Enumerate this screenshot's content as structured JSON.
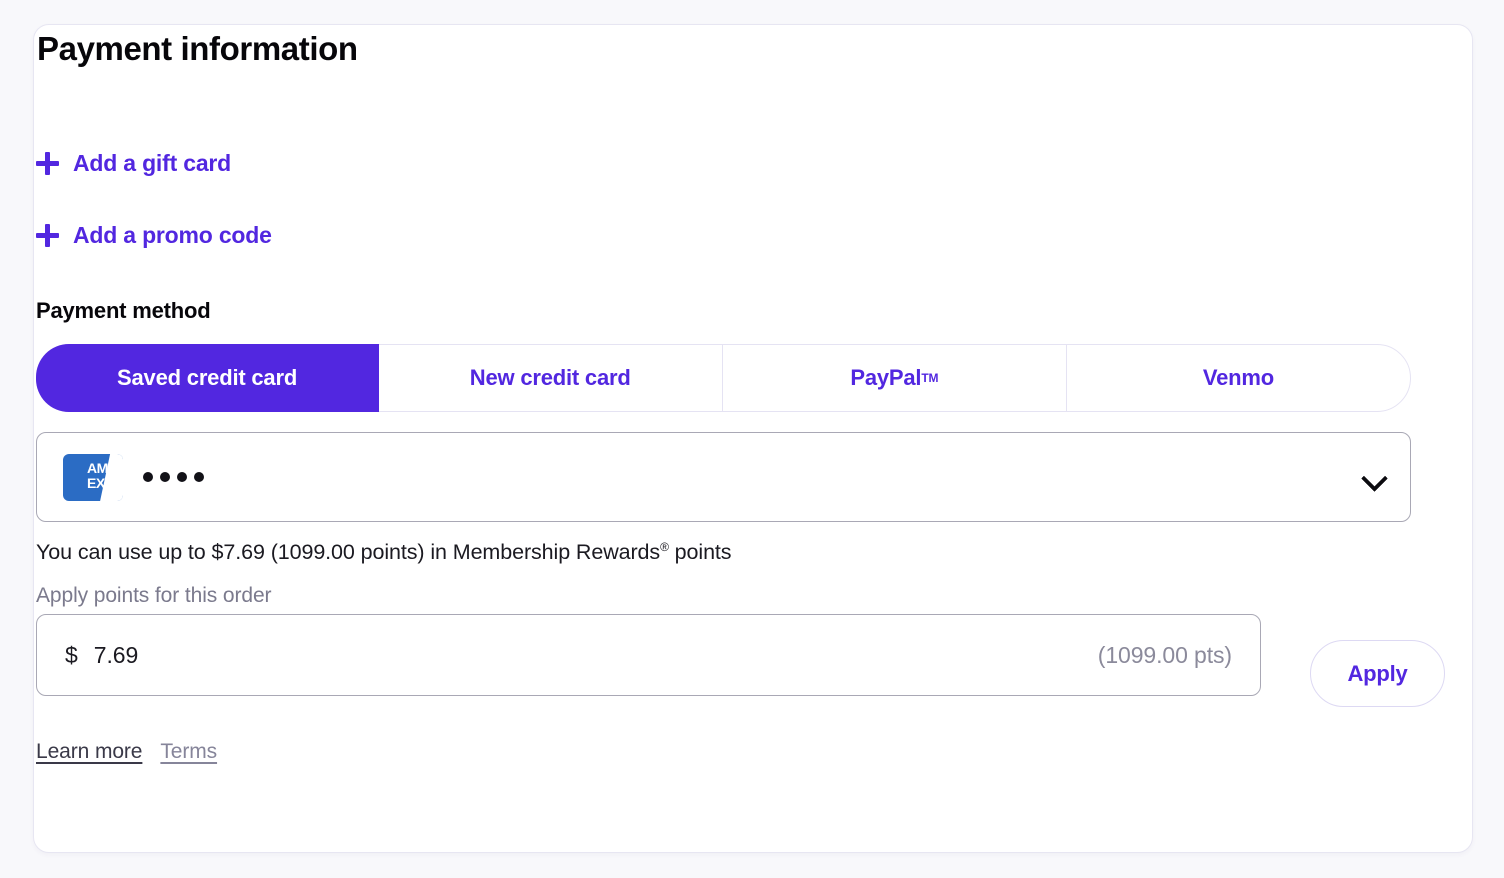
{
  "card": {
    "title": "Payment information",
    "links": [
      {
        "icon": "plus-icon",
        "label": "Add a gift card"
      },
      {
        "icon": "plus-icon",
        "label": "Add a promo code"
      }
    ],
    "payment_method": {
      "heading": "Payment method",
      "tabs": [
        {
          "label": "Saved credit card",
          "active": true
        },
        {
          "label": "New credit card",
          "active": false
        },
        {
          "label": "PayPal",
          "trademark": "TM",
          "active": false
        },
        {
          "label": "Venmo",
          "active": false
        }
      ],
      "saved_card": {
        "brand": "amex",
        "brand_line1": "AM",
        "brand_line2": "EX",
        "masked_digits": "••••",
        "dropdown_icon": "chevron-down-icon"
      }
    },
    "rewards": {
      "note_prefix": "You can use up to $7.69 (1099.00 points) in Membership Rewards",
      "note_mark": "®",
      "note_suffix": " points",
      "field_label": "Apply points for this order",
      "amount_prefix": "$",
      "amount_value": "7.69",
      "points_display": "(1099.00 pts)",
      "apply_label": "Apply"
    },
    "footer": {
      "learn_more": "Learn more",
      "terms": "Terms"
    }
  },
  "colors": {
    "accent": "#5227e0",
    "page_bg": "#f8f8fb",
    "card_border": "#e7e6f2",
    "field_border": "#a9a8b5",
    "muted_text": "#8b8a9b",
    "amex_blue": "#2b6cc4"
  }
}
